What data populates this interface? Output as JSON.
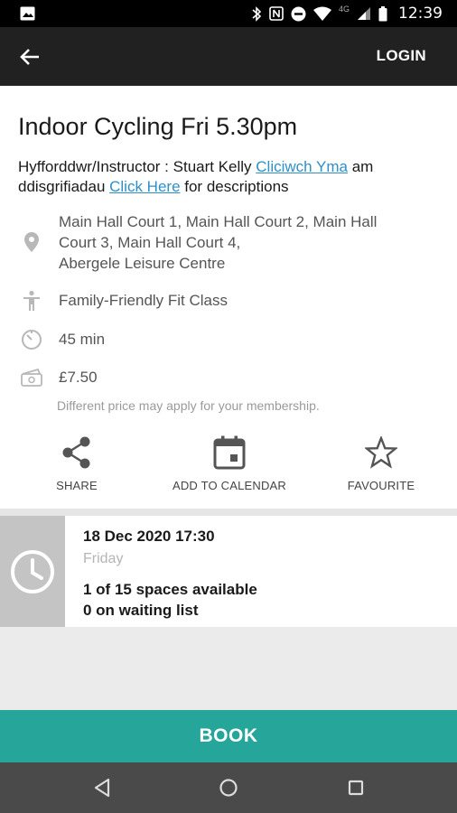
{
  "status_bar": {
    "time": "12:39",
    "network": "4G"
  },
  "app_bar": {
    "back_icon": "arrow-left-icon",
    "login_label": "LOGIN"
  },
  "class": {
    "title": "Indoor Cycling Fri 5.30pm",
    "description": {
      "prefix": "Hyfforddwr/Instructor : Stuart Kelly ",
      "link_cy": "Cliciwch Yma",
      "middle": " am ddisgrifiadau ",
      "link_en": "Click Here",
      "suffix": " for descriptions"
    },
    "location": {
      "line1": "Main Hall Court 1, Main Hall Court 2, Main Hall",
      "line2": "Court 3, Main Hall Court 4,",
      "line3": "Abergele Leisure Centre"
    },
    "category": "Family-Friendly Fit Class",
    "duration": "45 min",
    "price": "£7.50",
    "price_note": "Different price may apply for your membership."
  },
  "actions": {
    "share": "SHARE",
    "add_to_calendar": "ADD TO CALENDAR",
    "favourite": "FAVOURITE"
  },
  "session": {
    "datetime": "18 Dec 2020 17:30",
    "day": "Friday",
    "spaces": "1 of 15 spaces available",
    "waiting": "0 on waiting list"
  },
  "book_label": "BOOK",
  "colors": {
    "app_bar": "#212121",
    "book_button": "#26a69a",
    "link": "#2f8fc7",
    "nav_bar": "#4a4a4a"
  }
}
